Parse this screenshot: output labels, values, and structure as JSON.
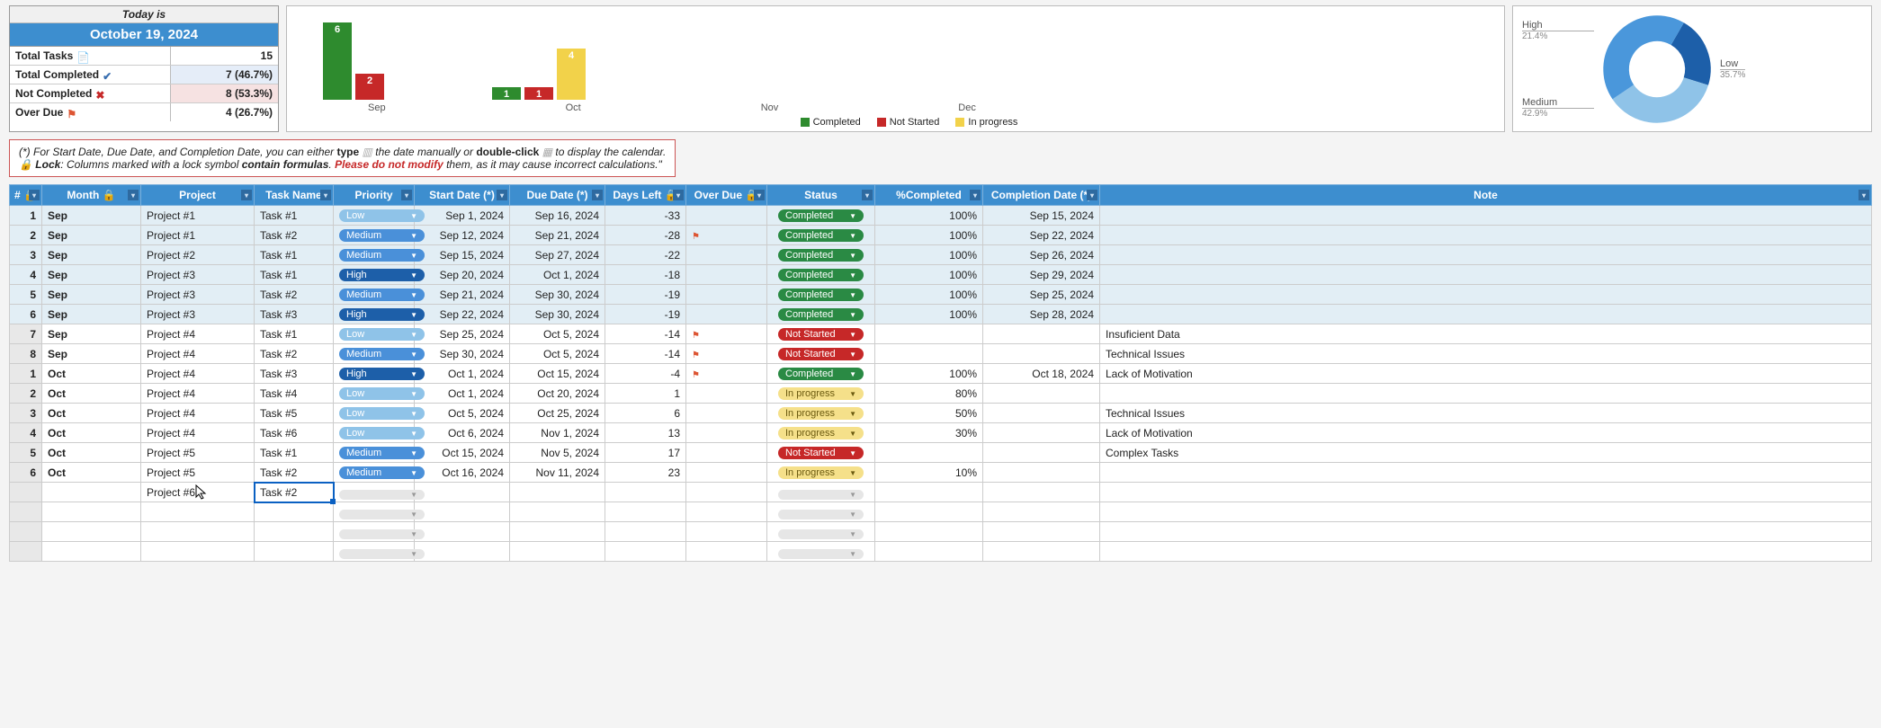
{
  "summary": {
    "today_label": "Today is",
    "today_date": "October 19, 2024",
    "rows": [
      {
        "label": "Total Tasks",
        "icon": "doc",
        "value": "15",
        "bg": "bg-white"
      },
      {
        "label": "Total Completed",
        "icon": "check",
        "value": "7  (46.7%)",
        "bg": "bg-pale-blue"
      },
      {
        "label": "Not Completed",
        "icon": "x",
        "value": "8  (53.3%)",
        "bg": "bg-pale-red"
      },
      {
        "label": "Over Due",
        "icon": "flag",
        "value": "4  (26.7%)",
        "bg": "bg-white"
      }
    ]
  },
  "chart_data": [
    {
      "type": "bar",
      "title": "",
      "xlabel": "",
      "ylabel": "",
      "categories": [
        "Sep",
        "Oct",
        "Nov",
        "Dec"
      ],
      "series": [
        {
          "name": "Completed",
          "color": "#2e8b2e",
          "values": [
            6,
            1,
            0,
            0
          ]
        },
        {
          "name": "Not Started",
          "color": "#c62828",
          "values": [
            2,
            1,
            0,
            0
          ]
        },
        {
          "name": "In progress",
          "color": "#f2d24a",
          "values": [
            0,
            4,
            0,
            0
          ]
        }
      ],
      "ylim": [
        0,
        7
      ]
    },
    {
      "type": "pie",
      "title": "",
      "series": [
        {
          "name": "High",
          "value": 21.4,
          "label": "21.4%",
          "color": "#1d5fa9"
        },
        {
          "name": "Medium",
          "value": 42.9,
          "label": "42.9%",
          "color": "#4a97db"
        },
        {
          "name": "Low",
          "value": 35.7,
          "label": "35.7%",
          "color": "#8fc3e8"
        }
      ]
    }
  ],
  "bar_legend": {
    "completed": "Completed",
    "not_started": "Not Started",
    "in_progress": "In progress"
  },
  "donut_labels": {
    "high": "High",
    "high_pct": "21.4%",
    "medium": "Medium",
    "medium_pct": "42.9%",
    "low": "Low",
    "low_pct": "35.7%"
  },
  "info": {
    "line1a": "(*) For Start Date, Due Date, and Completion Date, you can either ",
    "line1b": "type",
    "line1c": " the date manually or ",
    "line1d": "double-click",
    "line1e": " to display the calendar.",
    "line2a": "Lock",
    "line2b": ": Columns marked with a lock symbol ",
    "line2c": "contain formulas",
    "line2d": ". ",
    "line2e": "Please do not modify",
    "line2f": " them, as it may cause incorrect calculations.\""
  },
  "cols": {
    "id": "#",
    "month": "Month",
    "project": "Project",
    "task": "Task Name",
    "prio": "Priority",
    "start": "Start Date (*)",
    "due": "Due Date (*)",
    "daysleft": "Days Left",
    "overdue": "Over Due",
    "status": "Status",
    "pct": "%Completed",
    "compdate": "Completion Date (*)",
    "note": "Note"
  },
  "rows": [
    {
      "id": "1",
      "mon": "Sep",
      "proj": "Project #1",
      "task": "Task #1",
      "prio": "Low",
      "sd": "Sep 1, 2024",
      "dd": "Sep 16, 2024",
      "dl": "-33",
      "od": "",
      "st": "Completed",
      "pct": "100%",
      "cd": "Sep 15, 2024",
      "note": "",
      "comp": true
    },
    {
      "id": "2",
      "mon": "Sep",
      "proj": "Project #1",
      "task": "Task #2",
      "prio": "Medium",
      "sd": "Sep 12, 2024",
      "dd": "Sep 21, 2024",
      "dl": "-28",
      "od": "flag",
      "st": "Completed",
      "pct": "100%",
      "cd": "Sep 22, 2024",
      "note": "",
      "comp": true
    },
    {
      "id": "3",
      "mon": "Sep",
      "proj": "Project #2",
      "task": "Task #1",
      "prio": "Medium",
      "sd": "Sep 15, 2024",
      "dd": "Sep 27, 2024",
      "dl": "-22",
      "od": "",
      "st": "Completed",
      "pct": "100%",
      "cd": "Sep 26, 2024",
      "note": "",
      "comp": true
    },
    {
      "id": "4",
      "mon": "Sep",
      "proj": "Project #3",
      "task": "Task #1",
      "prio": "High",
      "sd": "Sep 20, 2024",
      "dd": "Oct 1, 2024",
      "dl": "-18",
      "od": "",
      "st": "Completed",
      "pct": "100%",
      "cd": "Sep 29, 2024",
      "note": "",
      "comp": true
    },
    {
      "id": "5",
      "mon": "Sep",
      "proj": "Project #3",
      "task": "Task #2",
      "prio": "Medium",
      "sd": "Sep 21, 2024",
      "dd": "Sep 30, 2024",
      "dl": "-19",
      "od": "",
      "st": "Completed",
      "pct": "100%",
      "cd": "Sep 25, 2024",
      "note": "",
      "comp": true
    },
    {
      "id": "6",
      "mon": "Sep",
      "proj": "Project #3",
      "task": "Task #3",
      "prio": "High",
      "sd": "Sep 22, 2024",
      "dd": "Sep 30, 2024",
      "dl": "-19",
      "od": "",
      "st": "Completed",
      "pct": "100%",
      "cd": "Sep 28, 2024",
      "note": "",
      "comp": true
    },
    {
      "id": "7",
      "mon": "Sep",
      "proj": "Project #4",
      "task": "Task #1",
      "prio": "Low",
      "sd": "Sep 25, 2024",
      "dd": "Oct 5, 2024",
      "dl": "-14",
      "od": "flag",
      "st": "Not Started",
      "pct": "",
      "cd": "",
      "note": "Insuficient Data",
      "comp": false
    },
    {
      "id": "8",
      "mon": "Sep",
      "proj": "Project #4",
      "task": "Task #2",
      "prio": "Medium",
      "sd": "Sep 30, 2024",
      "dd": "Oct 5, 2024",
      "dl": "-14",
      "od": "flag",
      "st": "Not Started",
      "pct": "",
      "cd": "",
      "note": "Technical Issues",
      "comp": false
    },
    {
      "id": "1",
      "mon": "Oct",
      "proj": "Project #4",
      "task": "Task #3",
      "prio": "High",
      "sd": "Oct 1, 2024",
      "dd": "Oct 15, 2024",
      "dl": "-4",
      "od": "flag",
      "st": "Completed",
      "pct": "100%",
      "cd": "Oct 18, 2024",
      "note": "Lack of Motivation",
      "comp": false
    },
    {
      "id": "2",
      "mon": "Oct",
      "proj": "Project #4",
      "task": "Task #4",
      "prio": "Low",
      "sd": "Oct 1, 2024",
      "dd": "Oct 20, 2024",
      "dl": "1",
      "od": "",
      "st": "In progress",
      "pct": "80%",
      "cd": "",
      "note": "",
      "comp": false
    },
    {
      "id": "3",
      "mon": "Oct",
      "proj": "Project #4",
      "task": "Task #5",
      "prio": "Low",
      "sd": "Oct 5, 2024",
      "dd": "Oct 25, 2024",
      "dl": "6",
      "od": "",
      "st": "In progress",
      "pct": "50%",
      "cd": "",
      "note": "Technical Issues",
      "comp": false
    },
    {
      "id": "4",
      "mon": "Oct",
      "proj": "Project #4",
      "task": "Task #6",
      "prio": "Low",
      "sd": "Oct 6, 2024",
      "dd": "Nov 1, 2024",
      "dl": "13",
      "od": "",
      "st": "In progress",
      "pct": "30%",
      "cd": "",
      "note": "Lack of Motivation",
      "comp": false
    },
    {
      "id": "5",
      "mon": "Oct",
      "proj": "Project #5",
      "task": "Task #1",
      "prio": "Medium",
      "sd": "Oct 15, 2024",
      "dd": "Nov 5, 2024",
      "dl": "17",
      "od": "",
      "st": "Not Started",
      "pct": "",
      "cd": "",
      "note": "Complex Tasks",
      "comp": false
    },
    {
      "id": "6",
      "mon": "Oct",
      "proj": "Project #5",
      "task": "Task #2",
      "prio": "Medium",
      "sd": "Oct 16, 2024",
      "dd": "Nov 11, 2024",
      "dl": "23",
      "od": "",
      "st": "In progress",
      "pct": "10%",
      "cd": "",
      "note": "",
      "comp": false
    },
    {
      "id": "",
      "mon": "",
      "proj": "Project #6",
      "task": "Task #2",
      "prio": "",
      "sd": "",
      "dd": "",
      "dl": "",
      "od": "",
      "st": "",
      "pct": "",
      "cd": "",
      "note": "",
      "comp": false,
      "selected": true,
      "cursor": true
    }
  ],
  "empty_rows": 3
}
